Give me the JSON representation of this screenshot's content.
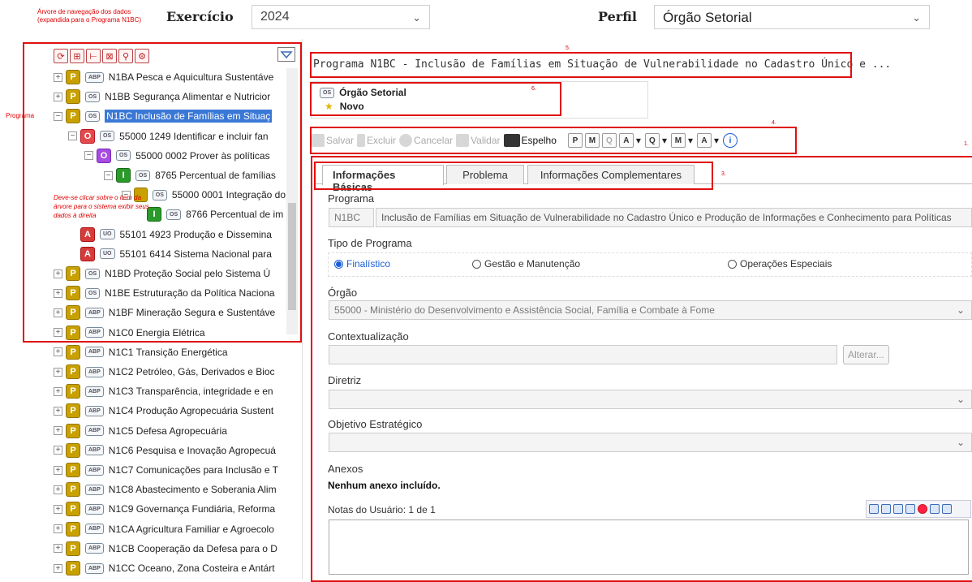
{
  "annotations": {
    "tree_note": "Árvore de navegação dos dados\n(expandida para o Programa N1BC)",
    "programa": "Programa",
    "click_note": "Deve-se clicar sobre o item da árvore para o sistema exibir seus dados à direita",
    "n1": "1.",
    "n3": "3.",
    "n4": "4.",
    "n5": "5.",
    "n6": "6."
  },
  "header": {
    "exercicio_label": "Exercício",
    "exercicio_value": "2024",
    "perfil_label": "Perfil",
    "perfil_value": "Órgão Setorial"
  },
  "tree": {
    "toolbar_icons": [
      "refresh-icon",
      "hierarchy-icon",
      "tree-icon",
      "filter-icon",
      "search-icon",
      "gear-icon"
    ],
    "rows": [
      {
        "exp": "+",
        "icon": "P",
        "tag": "ABP",
        "label": "N1BA Pesca e Aquicultura Sustentáve"
      },
      {
        "exp": "+",
        "icon": "P",
        "tag": "OS",
        "label": "N1BB Segurança Alimentar e Nutricior"
      },
      {
        "exp": "−",
        "icon": "P",
        "tag": "OS",
        "label": "N1BC Inclusão de Famílias em Situaç"
      },
      {
        "exp": "−",
        "icon": "O",
        "tag": "OS",
        "label": "55000 1249 Identificar e incluir fan"
      },
      {
        "exp": "−",
        "icon": "O",
        "tag": "OS",
        "label": "55000 0002 Prover às políticas"
      },
      {
        "exp": "−",
        "icon": "I",
        "tag": "OS",
        "label": "8765 Percentual de famílias"
      },
      {
        "exp": "−",
        "icon": "",
        "tag": "OS",
        "label": "55000 0001 Integração do"
      },
      {
        "exp": "",
        "icon": "I",
        "tag": "OS",
        "label": "8766 Percentual de im"
      },
      {
        "exp": "",
        "icon": "A",
        "tag": "UO",
        "label": "55101 4923 Produção e Dissemina"
      },
      {
        "exp": "",
        "icon": "A",
        "tag": "UO",
        "label": "55101 6414 Sistema Nacional para"
      },
      {
        "exp": "+",
        "icon": "P",
        "tag": "OS",
        "label": "N1BD Proteção Social pelo Sistema Ú"
      },
      {
        "exp": "+",
        "icon": "P",
        "tag": "OS",
        "label": "N1BE Estruturação da Política Naciona"
      },
      {
        "exp": "+",
        "icon": "P",
        "tag": "ABP",
        "label": "N1BF Mineração Segura e Sustentáve"
      },
      {
        "exp": "+",
        "icon": "P",
        "tag": "ABP",
        "label": "N1C0 Energia Elétrica"
      },
      {
        "exp": "+",
        "icon": "P",
        "tag": "ABP",
        "label": "N1C1 Transição Energética"
      },
      {
        "exp": "+",
        "icon": "P",
        "tag": "ABP",
        "label": "N1C2 Petróleo, Gás, Derivados e Bioc"
      },
      {
        "exp": "+",
        "icon": "P",
        "tag": "ABP",
        "label": "N1C3 Transparência, integridade e en"
      },
      {
        "exp": "+",
        "icon": "P",
        "tag": "ABP",
        "label": "N1C4 Produção Agropecuária Sustent"
      },
      {
        "exp": "+",
        "icon": "P",
        "tag": "ABP",
        "label": "N1C5 Defesa Agropecuária"
      },
      {
        "exp": "+",
        "icon": "P",
        "tag": "ABP",
        "label": "N1C6 Pesquisa e Inovação Agropecuá"
      },
      {
        "exp": "+",
        "icon": "P",
        "tag": "ABP",
        "label": "N1C7 Comunicações para Inclusão e T"
      },
      {
        "exp": "+",
        "icon": "P",
        "tag": "ABP",
        "label": "N1C8 Abastecimento e Soberania Alim"
      },
      {
        "exp": "+",
        "icon": "P",
        "tag": "ABP",
        "label": "N1C9 Governança Fundiária, Reforma"
      },
      {
        "exp": "+",
        "icon": "P",
        "tag": "ABP",
        "label": "N1CA Agricultura Familiar e Agroecolo"
      },
      {
        "exp": "+",
        "icon": "P",
        "tag": "ABP",
        "label": "N1CB Cooperação da Defesa para o D"
      },
      {
        "exp": "+",
        "icon": "P",
        "tag": "ABP",
        "label": "N1CC Oceano, Zona Costeira e Antárt"
      }
    ]
  },
  "main": {
    "program_title": "Programa N1BC - Inclusão de Famílias em Situação de Vulnerabilidade no Cadastro Único e ...",
    "state": {
      "tag": "OS",
      "profile": "Órgão Setorial",
      "status": "Novo"
    },
    "actions": {
      "salvar": "Salvar",
      "excluir": "Excluir",
      "cancelar": "Cancelar",
      "validar": "Validar",
      "espelho": "Espelho"
    },
    "mini_buttons": [
      "P",
      "M",
      "Q",
      "A",
      "Q",
      "M",
      "A",
      "i"
    ],
    "tabs": [
      "Informações Básicas",
      "Problema",
      "Informações Complementares"
    ],
    "programa_label": "Programa",
    "programa_code": "N1BC",
    "programa_name": "Inclusão de Famílias em Situação de Vulnerabilidade no Cadastro Único e Produção de Informações e Conhecimento para Políticas",
    "tipo_label": "Tipo de Programa",
    "tipo_options": [
      "Finalístico",
      "Gestão e Manutenção",
      "Operações Especiais"
    ],
    "orgao_label": "Órgão",
    "orgao_value": "55000 - Ministério do Desenvolvimento e Assistência Social, Família e Combate à Fome",
    "contextualizacao_label": "Contextualização",
    "alterar_label": "Alterar...",
    "diretriz_label": "Diretriz",
    "objetivo_label": "Objetivo Estratégico",
    "anexos_label": "Anexos",
    "anexos_value": "Nenhum anexo incluído.",
    "notas_label": "Notas do Usuário: 1 de 1"
  }
}
